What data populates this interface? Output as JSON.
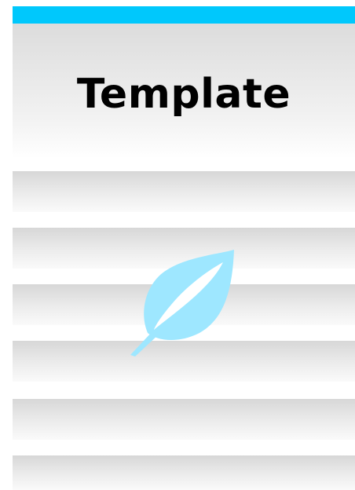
{
  "header": {
    "title": "Template"
  },
  "colors": {
    "accent_bar": "#00c8fc",
    "leaf": "#9ee7ff"
  },
  "icons": {
    "center_icon": "leaf-icon"
  }
}
